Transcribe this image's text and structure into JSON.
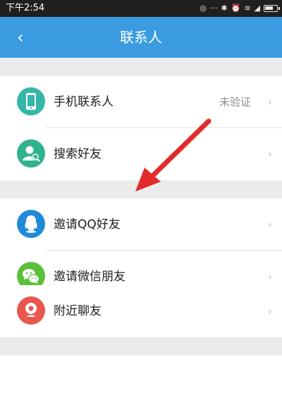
{
  "status_bar": {
    "time": "下午2:54",
    "icons": [
      "ring-icon",
      "more-icon",
      "bluetooth-icon",
      "alarm-icon",
      "wifi-icon",
      "signal-icon",
      "battery-icon"
    ]
  },
  "header": {
    "title": "联系人"
  },
  "sections": [
    {
      "items": [
        {
          "label": "手机联系人",
          "value": "未验证",
          "icon": "phone-icon",
          "color": "#34b7a8"
        },
        {
          "label": "搜索好友",
          "value": "",
          "icon": "search-friend-icon",
          "color": "#2fb38f"
        }
      ]
    },
    {
      "items": [
        {
          "label": "邀请QQ好友",
          "value": "",
          "icon": "qq-icon",
          "color": "#1f8bd8"
        },
        {
          "label": "邀请微信朋友",
          "value": "",
          "icon": "wechat-icon",
          "color": "#5bbf3a"
        }
      ]
    },
    {
      "items": [
        {
          "label": "附近聊友",
          "value": "",
          "icon": "nearby-icon",
          "color": "#e9574e"
        }
      ]
    }
  ],
  "colors": {
    "header_bg": "#3a9be0",
    "status_bar_bg": "#1f1f1f",
    "annotation_arrow": "#e32b2b"
  }
}
